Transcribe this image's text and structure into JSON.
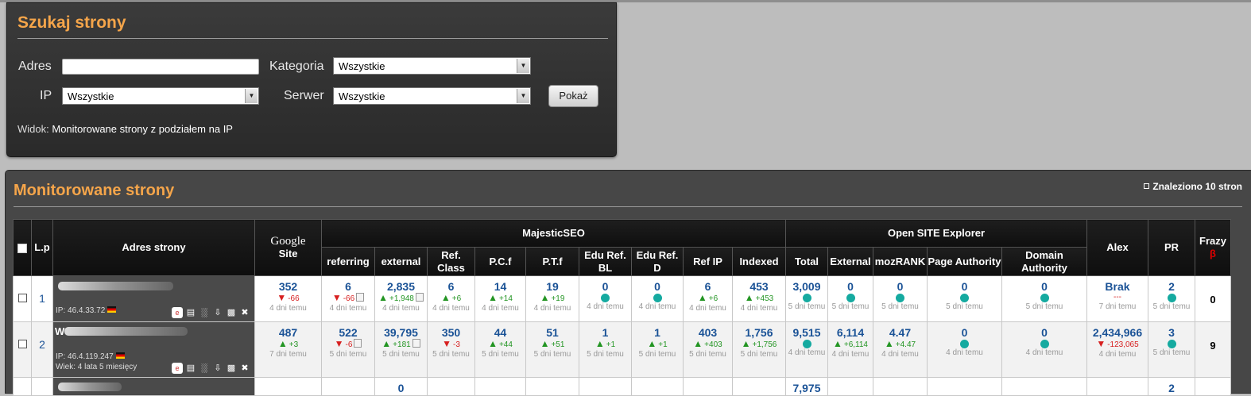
{
  "search": {
    "title": "Szukaj strony",
    "adres_label": "Adres",
    "adres_value": "",
    "kategoria_label": "Kategoria",
    "kategoria_value": "Wszystkie",
    "ip_label": "IP",
    "ip_value": "Wszystkie",
    "serwer_label": "Serwer",
    "serwer_value": "Wszystkie",
    "show_button": "Pokaż",
    "view_label": "Widok:",
    "view_value": "Monitorowane strony z podziałem na IP"
  },
  "monitored": {
    "title": "Monitorowane strony",
    "found": "Znaleziono 10 stron",
    "headers": {
      "lp": "L.p",
      "address": "Adres strony",
      "google_top": "Google",
      "google_bottom": "Site",
      "majestic": "MajesticSEO",
      "ose": "Open SITE Explorer",
      "alex": "Alex",
      "pr": "PR",
      "frazy": "Frazy",
      "frazy_sup": "β",
      "sub": [
        "referring",
        "external",
        "Ref. Class",
        "P.C.f",
        "P.T.f",
        "Edu Ref. BL",
        "Edu Ref. D",
        "Ref IP",
        "Indexed",
        "Total",
        "External",
        "mozRANK",
        "Page Authority",
        "Domain Authority"
      ]
    },
    "rows": [
      {
        "lp": "1",
        "ip": "IP: 46.4.33.72",
        "age": "",
        "cells": [
          {
            "v": "352",
            "c": "-66",
            "d": "dn",
            "a": "4 dni temu"
          },
          {
            "v": "6",
            "c": "-66",
            "d": "dn",
            "a": "4 dni temu",
            "mini": true
          },
          {
            "v": "2,835",
            "c": "+1,948",
            "d": "up",
            "a": "4 dni temu",
            "mini": true
          },
          {
            "v": "6",
            "c": "+6",
            "d": "up",
            "a": "4 dni temu"
          },
          {
            "v": "14",
            "c": "+14",
            "d": "up",
            "a": "4 dni temu"
          },
          {
            "v": "19",
            "c": "+19",
            "d": "up",
            "a": "4 dni temu"
          },
          {
            "v": "0",
            "c": "",
            "d": "dot",
            "a": "4 dni temu"
          },
          {
            "v": "0",
            "c": "",
            "d": "dot",
            "a": "4 dni temu"
          },
          {
            "v": "6",
            "c": "+6",
            "d": "up",
            "a": "4 dni temu"
          },
          {
            "v": "453",
            "c": "+453",
            "d": "up",
            "a": "4 dni temu"
          },
          {
            "v": "3,009",
            "c": "",
            "d": "dot",
            "a": "5 dni temu"
          },
          {
            "v": "0",
            "c": "",
            "d": "dot",
            "a": "5 dni temu"
          },
          {
            "v": "0",
            "c": "",
            "d": "dot",
            "a": "5 dni temu"
          },
          {
            "v": "0",
            "c": "",
            "d": "dot",
            "a": "5 dni temu"
          },
          {
            "v": "0",
            "c": "",
            "d": "dot",
            "a": "5 dni temu"
          },
          {
            "v": "Brak",
            "c": "---",
            "d": "none",
            "a": "7 dni temu"
          },
          {
            "v": "2",
            "c": "",
            "d": "dot",
            "a": "5 dni temu"
          }
        ],
        "frazy": "0"
      },
      {
        "lp": "2",
        "ip": "IP: 46.4.119.247",
        "age": "Wiek: 4 lata 5 miesięcy",
        "cells": [
          {
            "v": "487",
            "c": "+3",
            "d": "up",
            "a": "7 dni temu"
          },
          {
            "v": "522",
            "c": "-6",
            "d": "dn",
            "a": "5 dni temu",
            "mini": true
          },
          {
            "v": "39,795",
            "c": "+181",
            "d": "up",
            "a": "5 dni temu",
            "mini": true
          },
          {
            "v": "350",
            "c": "-3",
            "d": "dn",
            "a": "5 dni temu"
          },
          {
            "v": "44",
            "c": "+44",
            "d": "up",
            "a": "5 dni temu"
          },
          {
            "v": "51",
            "c": "+51",
            "d": "up",
            "a": "5 dni temu"
          },
          {
            "v": "1",
            "c": "+1",
            "d": "up",
            "a": "5 dni temu"
          },
          {
            "v": "1",
            "c": "+1",
            "d": "up",
            "a": "5 dni temu"
          },
          {
            "v": "403",
            "c": "+403",
            "d": "up",
            "a": "5 dni temu"
          },
          {
            "v": "1,756",
            "c": "+1,756",
            "d": "up",
            "a": "5 dni temu"
          },
          {
            "v": "9,515",
            "c": "",
            "d": "dot",
            "a": "4 dni temu"
          },
          {
            "v": "6,114",
            "c": "+6,114",
            "d": "up",
            "a": "4 dni temu"
          },
          {
            "v": "4.47",
            "c": "+4.47",
            "d": "up",
            "a": "4 dni temu"
          },
          {
            "v": "0",
            "c": "",
            "d": "dot",
            "a": "4 dni temu"
          },
          {
            "v": "0",
            "c": "",
            "d": "dot",
            "a": "4 dni temu"
          },
          {
            "v": "2,434,966",
            "c": "-123,065",
            "d": "dn",
            "a": "4 dni temu"
          },
          {
            "v": "3",
            "c": "",
            "d": "dot",
            "a": "5 dni temu"
          }
        ],
        "frazy": "9"
      },
      {
        "lp": "",
        "ip": "",
        "age": "",
        "cells": [
          {
            "v": "",
            "c": "",
            "d": "none",
            "a": ""
          },
          {
            "v": "",
            "c": "",
            "d": "none",
            "a": ""
          },
          {
            "v": "0",
            "c": "",
            "d": "none",
            "a": ""
          },
          {
            "v": "",
            "c": "",
            "d": "none",
            "a": ""
          },
          {
            "v": "",
            "c": "",
            "d": "none",
            "a": ""
          },
          {
            "v": "",
            "c": "",
            "d": "none",
            "a": ""
          },
          {
            "v": "",
            "c": "",
            "d": "none",
            "a": ""
          },
          {
            "v": "",
            "c": "",
            "d": "none",
            "a": ""
          },
          {
            "v": "",
            "c": "",
            "d": "none",
            "a": ""
          },
          {
            "v": "",
            "c": "",
            "d": "none",
            "a": ""
          },
          {
            "v": "7,975",
            "c": "",
            "d": "none",
            "a": ""
          },
          {
            "v": "",
            "c": "",
            "d": "none",
            "a": ""
          },
          {
            "v": "",
            "c": "",
            "d": "none",
            "a": ""
          },
          {
            "v": "",
            "c": "",
            "d": "none",
            "a": ""
          },
          {
            "v": "",
            "c": "",
            "d": "none",
            "a": ""
          },
          {
            "v": "",
            "c": "",
            "d": "none",
            "a": ""
          },
          {
            "v": "2",
            "c": "",
            "d": "none",
            "a": ""
          }
        ],
        "frazy": ""
      }
    ]
  }
}
